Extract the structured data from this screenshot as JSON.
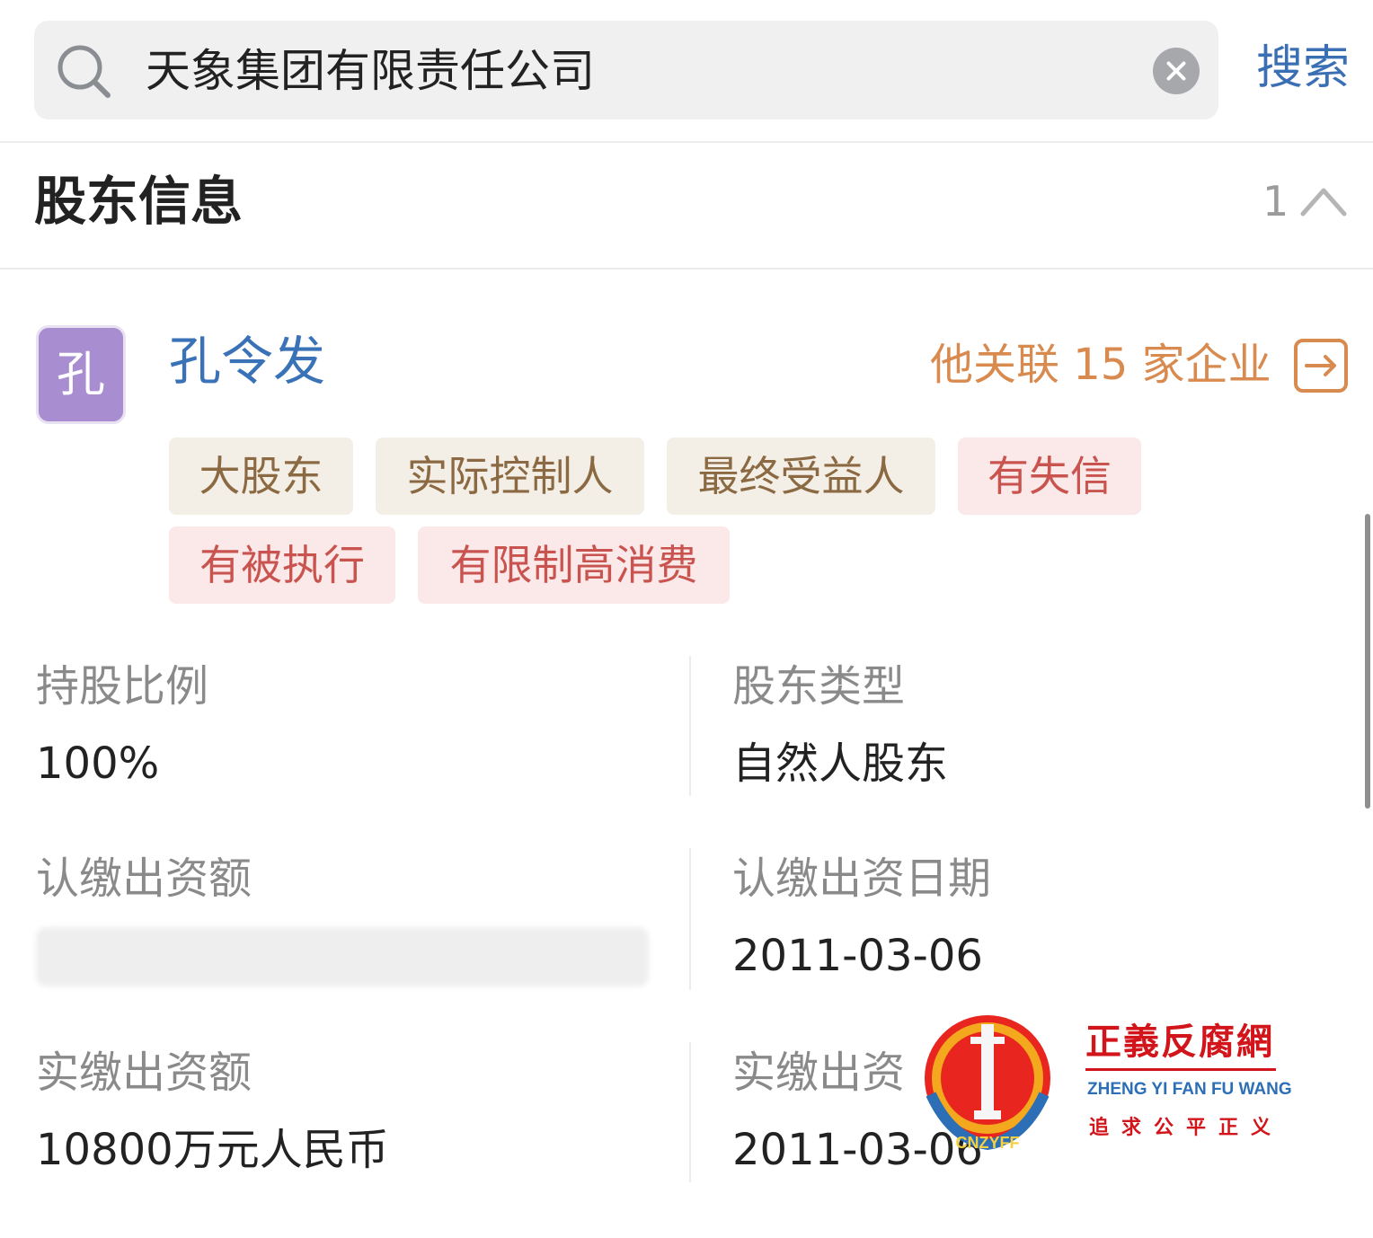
{
  "search": {
    "query": "天象集团有限责任公司",
    "submit_label": "搜索"
  },
  "section": {
    "title": "股东信息",
    "count": "1"
  },
  "shareholder": {
    "avatar_text": "孔",
    "name": "孔令发",
    "related_label": "他关联 15 家企业",
    "tags": [
      {
        "label": "大股东",
        "style": "neutral"
      },
      {
        "label": "实际控制人",
        "style": "neutral"
      },
      {
        "label": "最终受益人",
        "style": "neutral"
      },
      {
        "label": "有失信",
        "style": "danger"
      },
      {
        "label": "有被执行",
        "style": "danger"
      },
      {
        "label": "有限制高消费",
        "style": "danger"
      }
    ],
    "fields": [
      {
        "label": "持股比例",
        "value": "100%"
      },
      {
        "label": "股东类型",
        "value": "自然人股东"
      },
      {
        "label": "认缴出资额",
        "value": ""
      },
      {
        "label": "认缴出资日期",
        "value": "2011-03-06"
      },
      {
        "label": "实缴出资额",
        "value": "10800万元人民币"
      },
      {
        "label": "实缴出资",
        "value": "2011-03-06"
      }
    ]
  },
  "watermark": {
    "title": "正義反腐網",
    "subtitle": "ZHENG YI FAN FU WANG",
    "slogan": "追求公平正义",
    "emblem_text": "CNZYFF"
  },
  "colors": {
    "link_blue": "#3a72b8",
    "related_orange": "#d98a4e",
    "tag_neutral_bg": "#f4efe6",
    "tag_neutral_text": "#8b6a43",
    "tag_danger_bg": "#fbe8e8",
    "tag_danger_text": "#c9544f",
    "avatar_bg": "#a88ed1",
    "watermark_red": "#d2141b"
  },
  "icons": [
    "search-icon",
    "clear-icon",
    "chevron-up-icon",
    "arrow-right-box-icon"
  ]
}
